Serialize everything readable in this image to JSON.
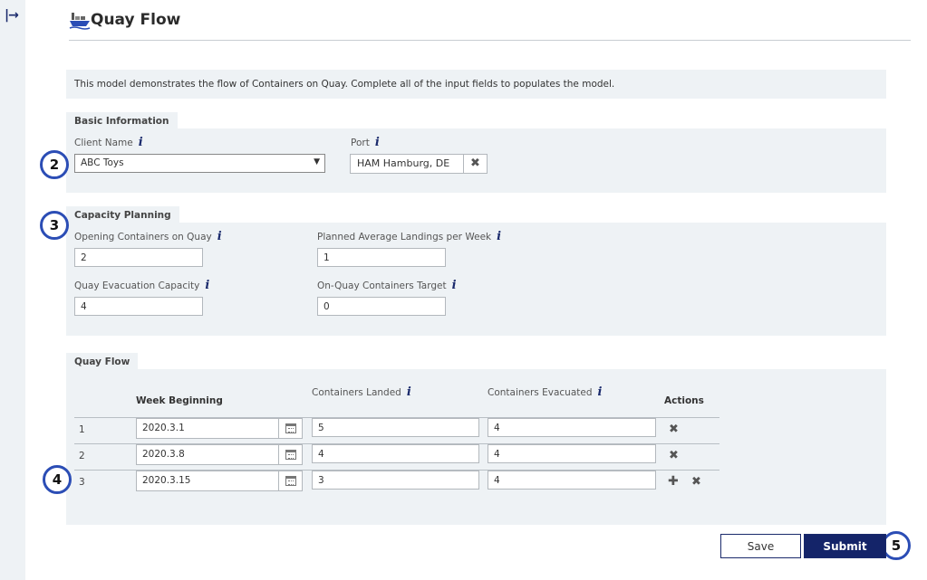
{
  "sidebar": {
    "expand_icon": "expand-arrow-icon"
  },
  "header": {
    "title": "Quay Flow",
    "logo_icon": "ship-logo-icon"
  },
  "intro": {
    "text": "This model demonstrates the flow of Containers on Quay. Complete all of the input fields to populates the model."
  },
  "basic_information": {
    "title": "Basic Information",
    "client_name": {
      "label": "Client Name",
      "value": "ABC Toys"
    },
    "port": {
      "label": "Port",
      "value": "HAM Hamburg, DE"
    }
  },
  "capacity_planning": {
    "title": "Capacity Planning",
    "opening_containers": {
      "label": "Opening Containers on Quay",
      "value": "2"
    },
    "planned_landings": {
      "label": "Planned Average Landings per Week",
      "value": "1"
    },
    "evacuation_capacity": {
      "label": "Quay Evacuation Capacity",
      "value": "4"
    },
    "containers_target": {
      "label": "On-Quay Containers Target",
      "value": "0"
    }
  },
  "quay_flow": {
    "title": "Quay Flow",
    "columns": {
      "week_beginning": "Week Beginning",
      "containers_landed": "Containers Landed",
      "containers_evacuated": "Containers Evacuated",
      "actions": "Actions"
    },
    "rows": [
      {
        "index": "1",
        "week": "2020.3.1",
        "landed": "5",
        "evacuated": "4"
      },
      {
        "index": "2",
        "week": "2020.3.8",
        "landed": "4",
        "evacuated": "4"
      },
      {
        "index": "3",
        "week": "2020.3.15",
        "landed": "3",
        "evacuated": "4"
      }
    ]
  },
  "markers": [
    "2",
    "3",
    "4",
    "5"
  ],
  "info_glyph": "i",
  "buttons": {
    "save": "Save",
    "submit": "Submit"
  },
  "colors": {
    "accent": "#142469",
    "panel": "#eef2f5",
    "marker": "#2b4db5"
  }
}
